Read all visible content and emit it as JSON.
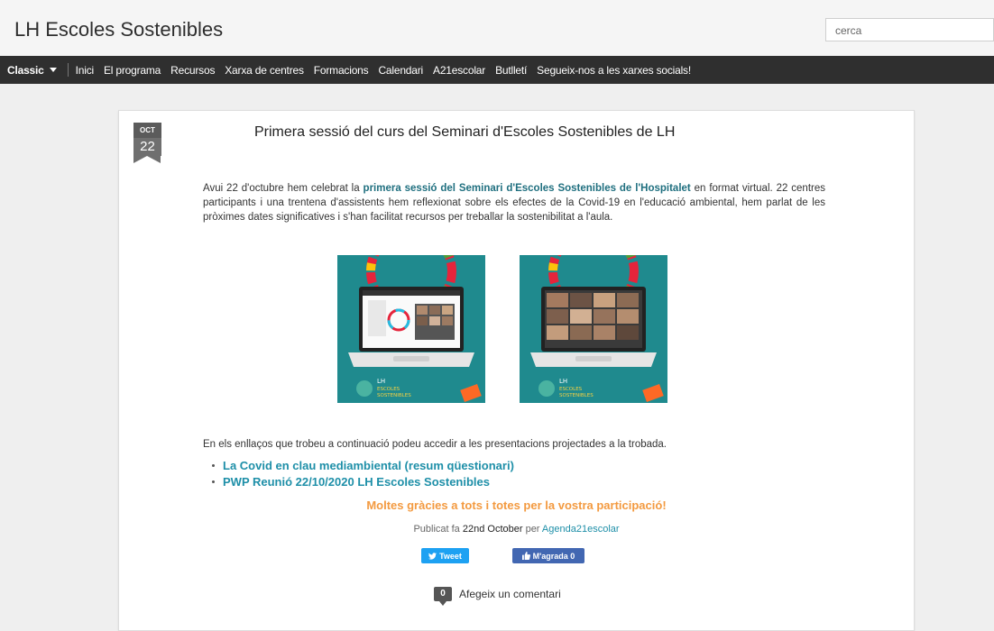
{
  "header": {
    "site_title": "LH Escoles Sostenibles",
    "search_placeholder": "cerca"
  },
  "nav": {
    "classic_label": "Classic",
    "items": [
      "Inici",
      "El programa",
      "Recursos",
      "Xarxa de centres",
      "Formacions",
      "Calendari",
      "A21escolar",
      "Butlletí",
      "Segueix-nos a les xarxes socials!"
    ]
  },
  "post": {
    "date_month": "OCT",
    "date_day": "22",
    "title": "Primera sessió del curs del Seminari d'Escoles Sostenibles de LH",
    "para_before": "Avui 22 d'octubre hem celebrat la ",
    "para_link": "primera sessió del Seminari d'Escoles Sostenibles de l'Hospitalet",
    "para_after": " en format virtual. 22 centres participants i una trentena d'assistents hem reflexionat sobre els efectes de la Covid-19 en l'educació ambiental, hem parlat de les pròximes dates significatives i s'han facilitat recursos per treballar la sostenibilitat a l'aula.",
    "links_intro": "En els enllaços que trobeu a continuació podeu accedir a les presentacions projectades a la trobada.",
    "links": [
      "La Covid en clau mediambiental (resum qüestionari)",
      "PWP Reunió 22/10/2020 LH Escoles Sostenibles"
    ],
    "thanks": "Moltes gràcies a tots i totes per la vostra participació!",
    "meta_prefix": "Publicat fa ",
    "meta_date": "22nd October",
    "meta_by": " per ",
    "meta_author": "Agenda21escolar",
    "tweet_label": "Tweet",
    "like_label": "M'agrada 0",
    "comment_count": "0",
    "comment_label": "Afegeix un comentari",
    "image_logo_text": [
      "LH",
      "ESCOLES",
      "SOSTENIBLES"
    ]
  },
  "colors": {
    "nav_bg": "#2f2f2f",
    "link": "#1e8fa8",
    "thanks": "#f39a40",
    "tweet": "#1da1f2",
    "like": "#4267b2",
    "image_bg": "#1f8a8e"
  }
}
